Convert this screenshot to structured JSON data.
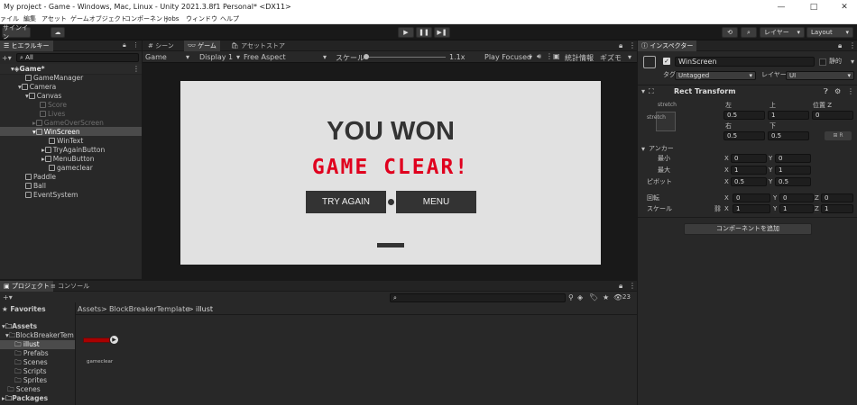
{
  "window": {
    "title": "My project - Game - Windows, Mac, Linux - Unity 2021.3.8f1 Personal* <DX11>",
    "minimize": "—",
    "maximize": "□",
    "close": "✕"
  },
  "menu": [
    "ァイル",
    "編集",
    "アセット",
    "ゲームオブジェクト",
    "コンポーネント",
    "Jobs",
    "ウィンドウ",
    "ヘルプ"
  ],
  "toolbar": {
    "signin": "サインイン",
    "layers": "レイヤー",
    "layout": "Layout"
  },
  "hierarchy": {
    "tab": "ヒエラルキー",
    "search_placeholder": "All",
    "items": [
      {
        "label": "Game*",
        "depth": 0,
        "dim": false
      },
      {
        "label": "GameManager",
        "depth": 1,
        "dim": false
      },
      {
        "label": "Camera",
        "depth": 1,
        "dim": false
      },
      {
        "label": "Canvas",
        "depth": 2,
        "dim": false
      },
      {
        "label": "Score",
        "depth": 3,
        "dim": true
      },
      {
        "label": "Lives",
        "depth": 3,
        "dim": true
      },
      {
        "label": "GameOverScreen",
        "depth": 3,
        "dim": true
      },
      {
        "label": "WinScreen",
        "depth": 3,
        "dim": false
      },
      {
        "label": "WinText",
        "depth": 4,
        "dim": false
      },
      {
        "label": "TryAgainButton",
        "depth": 4,
        "dim": false
      },
      {
        "label": "MenuButton",
        "depth": 4,
        "dim": false
      },
      {
        "label": "gameclear",
        "depth": 4,
        "dim": false
      },
      {
        "label": "Paddle",
        "depth": 1,
        "dim": false
      },
      {
        "label": "Ball",
        "depth": 1,
        "dim": false
      },
      {
        "label": "EventSystem",
        "depth": 1,
        "dim": false
      }
    ]
  },
  "scene_tabs": [
    "シーン",
    "ゲーム",
    "アセットストア"
  ],
  "game_toolbar": {
    "mode": "Game",
    "display": "Display 1",
    "aspect": "Free Aspect",
    "scale_label": "スケール",
    "scale_value": "1.1x",
    "play_focused": "Play Focused",
    "stats": "統計情報",
    "gizmos": "ギズモ"
  },
  "game": {
    "title": "YOU WON",
    "subtitle": "GAME CLEAR!",
    "try_again": "TRY AGAIN",
    "menu": "MENU"
  },
  "inspector": {
    "tab": "インスペクター",
    "object_name": "WinScreen",
    "static_label": "静的",
    "tag_label": "タグ",
    "tag_value": "Untagged",
    "layer_label": "レイヤー",
    "layer_value": "UI",
    "component": "Rect Transform",
    "stretch": "stretch",
    "left_label": "左",
    "top_label": "上",
    "posz_label": "位置 Z",
    "left_value": "0.5",
    "top_value": "1",
    "posz_value": "0",
    "right_label": "右",
    "bottom_label": "下",
    "right_value": "0.5",
    "bottom_value": "0.5",
    "anchor_label": "アンカー",
    "min_label": "最小",
    "max_label": "最大",
    "pivot_label": "ピボット",
    "min_x": "0",
    "min_y": "0",
    "max_x": "1",
    "max_y": "1",
    "pivot_x": "0.5",
    "pivot_y": "0.5",
    "rotation_label": "回転",
    "scale_label": "スケール",
    "rot_x": "0",
    "rot_y": "0",
    "rot_z": "0",
    "scale_x": "1",
    "scale_y": "1",
    "scale_z": "1",
    "add_component": "コンポーネントを追加"
  },
  "project": {
    "tab_project": "プロジェクト",
    "tab_console": "コンソール",
    "breadcrumb": [
      "Assets",
      "BlockBreakerTemplate",
      "illust"
    ],
    "count": "23",
    "favorites": "Favorites",
    "tree": [
      {
        "label": "Assets",
        "depth": 0,
        "bold": true
      },
      {
        "label": "BlockBreakerTem",
        "depth": 1,
        "bold": false
      },
      {
        "label": "illust",
        "depth": 2,
        "bold": false
      },
      {
        "label": "Prefabs",
        "depth": 2,
        "bold": false
      },
      {
        "label": "Scenes",
        "depth": 2,
        "bold": false
      },
      {
        "label": "Scripts",
        "depth": 2,
        "bold": false
      },
      {
        "label": "Sprites",
        "depth": 2,
        "bold": false
      },
      {
        "label": "Scenes",
        "depth": 1,
        "bold": false
      },
      {
        "label": "Packages",
        "depth": 0,
        "bold": true
      }
    ],
    "asset_name": "gameclear"
  },
  "colors": {
    "accent_red": "#e0001e",
    "selected": "#2c5d87"
  }
}
